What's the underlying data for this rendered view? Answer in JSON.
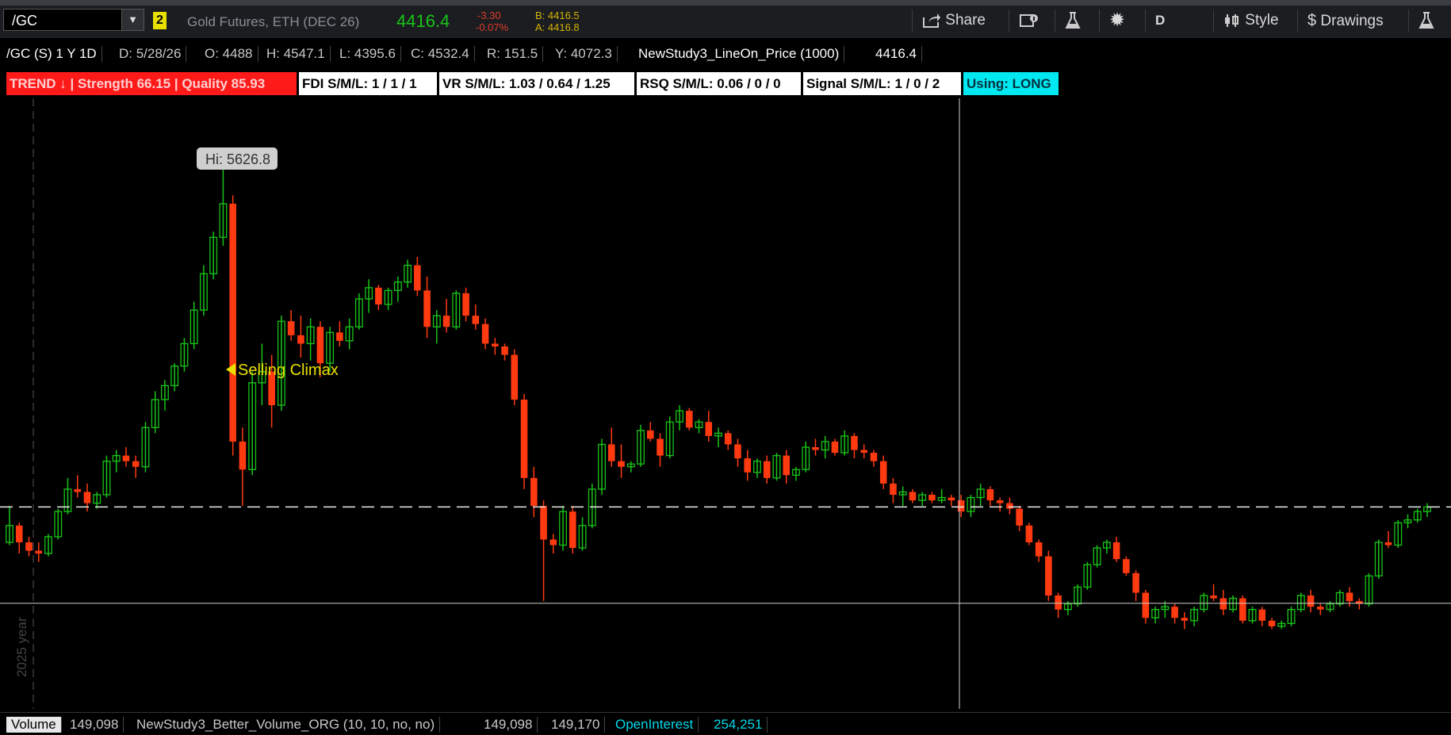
{
  "toolbar": {
    "symbol": "/GC",
    "link_badge": "2",
    "description": "Gold Futures, ETH (DEC 26)",
    "last": "4416.4",
    "change_abs": "-3.30",
    "change_pct": "-0.07%",
    "bid": "B: 4416.5",
    "ask": "A: 4416.8",
    "share_label": "Share",
    "aggregation_label": "D",
    "style_label": "Style",
    "drawings_label": "Drawings",
    "accent_color": "#18c418",
    "negative_color": "#e03a2a"
  },
  "info_row": {
    "chart_id": "/GC (S) 1 Y 1D",
    "date": "D: 5/28/26",
    "open": "O: 4488",
    "high": "H: 4547.1",
    "low": "L: 4395.6",
    "close": "C: 4532.4",
    "range": "R: 151.5",
    "y": "Y: 4072.3",
    "study": "NewStudy3_LineOn_Price (1000)",
    "study_value": "4416.4"
  },
  "labels": {
    "trend": "TREND ↓ | Strength 66.15 | Quality 85.93",
    "fdi": "FDI S/M/L: 1 / 1 / 1",
    "vr": "VR  S/M/L: 1.03 / 0.64 / 1.25",
    "rsq": "RSQ S/M/L: 0.06 / 0 / 0",
    "signal": "Signal S/M/L: 1 / 0 / 2",
    "using": "Using: LONG"
  },
  "chart_data": {
    "type": "candlestick",
    "hi_bubble": "Hi: 5626.8",
    "annotation": "Selling Climax",
    "year_label": "2025 year",
    "up_color": "#18c418",
    "down_color": "#ff3a10",
    "ohlc": [
      [
        4290,
        4420,
        4280,
        4350
      ],
      [
        4350,
        4360,
        4250,
        4290
      ],
      [
        4290,
        4310,
        4240,
        4260
      ],
      [
        4260,
        4290,
        4220,
        4250
      ],
      [
        4250,
        4320,
        4240,
        4310
      ],
      [
        4310,
        4410,
        4300,
        4400
      ],
      [
        4400,
        4520,
        4390,
        4480
      ],
      [
        4480,
        4530,
        4450,
        4470
      ],
      [
        4470,
        4500,
        4400,
        4430
      ],
      [
        4430,
        4470,
        4410,
        4460
      ],
      [
        4460,
        4600,
        4450,
        4580
      ],
      [
        4580,
        4620,
        4540,
        4600
      ],
      [
        4600,
        4630,
        4560,
        4580
      ],
      [
        4580,
        4600,
        4520,
        4560
      ],
      [
        4560,
        4720,
        4540,
        4700
      ],
      [
        4700,
        4830,
        4680,
        4800
      ],
      [
        4800,
        4870,
        4760,
        4850
      ],
      [
        4850,
        4930,
        4830,
        4920
      ],
      [
        4920,
        5020,
        4900,
        5000
      ],
      [
        5000,
        5150,
        4980,
        5120
      ],
      [
        5120,
        5280,
        5100,
        5250
      ],
      [
        5250,
        5400,
        5230,
        5380
      ],
      [
        5380,
        5627,
        5350,
        5500
      ],
      [
        5500,
        5530,
        4600,
        4650
      ],
      [
        4650,
        4700,
        4420,
        4550
      ],
      [
        4550,
        4900,
        4530,
        4860
      ],
      [
        4860,
        5000,
        4780,
        4900
      ],
      [
        4900,
        4960,
        4700,
        4780
      ],
      [
        4780,
        5100,
        4760,
        5080
      ],
      [
        5080,
        5120,
        5010,
        5030
      ],
      [
        5030,
        5100,
        4950,
        5000
      ],
      [
        5000,
        5090,
        4940,
        5060
      ],
      [
        5060,
        5080,
        4880,
        4930
      ],
      [
        4930,
        5060,
        4900,
        5040
      ],
      [
        5040,
        5080,
        4990,
        5010
      ],
      [
        5010,
        5090,
        4980,
        5060
      ],
      [
        5060,
        5180,
        5050,
        5160
      ],
      [
        5160,
        5230,
        5110,
        5200
      ],
      [
        5200,
        5210,
        5120,
        5140
      ],
      [
        5140,
        5200,
        5120,
        5190
      ],
      [
        5190,
        5240,
        5150,
        5220
      ],
      [
        5220,
        5300,
        5200,
        5280
      ],
      [
        5280,
        5310,
        5170,
        5190
      ],
      [
        5190,
        5240,
        5020,
        5060
      ],
      [
        5060,
        5120,
        5000,
        5100
      ],
      [
        5100,
        5160,
        5040,
        5060
      ],
      [
        5060,
        5190,
        5050,
        5180
      ],
      [
        5180,
        5200,
        5080,
        5100
      ],
      [
        5100,
        5140,
        5050,
        5070
      ],
      [
        5070,
        5090,
        4980,
        5000
      ],
      [
        5000,
        5020,
        4960,
        4990
      ],
      [
        4990,
        5000,
        4940,
        4960
      ],
      [
        4960,
        4980,
        4780,
        4800
      ],
      [
        4800,
        4820,
        4480,
        4520
      ],
      [
        4520,
        4560,
        4380,
        4420
      ],
      [
        4420,
        4440,
        4080,
        4300
      ],
      [
        4300,
        4320,
        4250,
        4280
      ],
      [
        4280,
        4420,
        4260,
        4400
      ],
      [
        4400,
        4420,
        4250,
        4270
      ],
      [
        4270,
        4380,
        4260,
        4350
      ],
      [
        4350,
        4500,
        4340,
        4480
      ],
      [
        4480,
        4660,
        4460,
        4640
      ],
      [
        4640,
        4700,
        4560,
        4580
      ],
      [
        4580,
        4640,
        4520,
        4560
      ],
      [
        4560,
        4580,
        4540,
        4570
      ],
      [
        4570,
        4710,
        4560,
        4690
      ],
      [
        4690,
        4720,
        4650,
        4660
      ],
      [
        4660,
        4680,
        4560,
        4600
      ],
      [
        4600,
        4740,
        4590,
        4720
      ],
      [
        4720,
        4780,
        4690,
        4760
      ],
      [
        4760,
        4770,
        4690,
        4700
      ],
      [
        4700,
        4730,
        4680,
        4720
      ],
      [
        4720,
        4760,
        4650,
        4670
      ],
      [
        4670,
        4700,
        4630,
        4680
      ],
      [
        4680,
        4690,
        4620,
        4640
      ],
      [
        4640,
        4660,
        4560,
        4590
      ],
      [
        4590,
        4620,
        4510,
        4540
      ],
      [
        4540,
        4590,
        4520,
        4580
      ],
      [
        4580,
        4600,
        4500,
        4520
      ],
      [
        4520,
        4610,
        4510,
        4600
      ],
      [
        4600,
        4620,
        4500,
        4530
      ],
      [
        4530,
        4560,
        4510,
        4550
      ],
      [
        4550,
        4650,
        4540,
        4630
      ],
      [
        4630,
        4660,
        4600,
        4620
      ],
      [
        4620,
        4670,
        4590,
        4650
      ],
      [
        4650,
        4660,
        4600,
        4610
      ],
      [
        4610,
        4690,
        4600,
        4670
      ],
      [
        4670,
        4680,
        4590,
        4620
      ],
      [
        4620,
        4640,
        4590,
        4610
      ],
      [
        4610,
        4620,
        4560,
        4580
      ],
      [
        4580,
        4600,
        4480,
        4500
      ],
      [
        4500,
        4520,
        4430,
        4460
      ],
      [
        4460,
        4490,
        4420,
        4470
      ],
      [
        4470,
        4480,
        4430,
        4440
      ],
      [
        4440,
        4470,
        4420,
        4460
      ],
      [
        4460,
        4470,
        4430,
        4440
      ],
      [
        4440,
        4480,
        4430,
        4450
      ],
      [
        4450,
        4460,
        4420,
        4440
      ],
      [
        4440,
        4460,
        4380,
        4400
      ],
      [
        4400,
        4460,
        4380,
        4450
      ],
      [
        4450,
        4500,
        4420,
        4480
      ],
      [
        4480,
        4490,
        4420,
        4440
      ],
      [
        4440,
        4450,
        4400,
        4430
      ],
      [
        4430,
        4450,
        4390,
        4410
      ],
      [
        4410,
        4420,
        4330,
        4350
      ],
      [
        4350,
        4360,
        4280,
        4290
      ],
      [
        4290,
        4300,
        4220,
        4240
      ],
      [
        4240,
        4260,
        4080,
        4100
      ],
      [
        4100,
        4110,
        4020,
        4050
      ],
      [
        4050,
        4080,
        4030,
        4070
      ],
      [
        4070,
        4140,
        4060,
        4130
      ],
      [
        4130,
        4220,
        4120,
        4210
      ],
      [
        4210,
        4280,
        4200,
        4270
      ],
      [
        4270,
        4300,
        4250,
        4290
      ],
      [
        4290,
        4310,
        4220,
        4230
      ],
      [
        4230,
        4240,
        4170,
        4180
      ],
      [
        4180,
        4190,
        4080,
        4110
      ],
      [
        4110,
        4120,
        4000,
        4020
      ],
      [
        4020,
        4060,
        4000,
        4050
      ],
      [
        4050,
        4080,
        4020,
        4060
      ],
      [
        4060,
        4070,
        4000,
        4020
      ],
      [
        4020,
        4040,
        3980,
        4010
      ],
      [
        4010,
        4060,
        3990,
        4050
      ],
      [
        4050,
        4110,
        4040,
        4100
      ],
      [
        4100,
        4140,
        4080,
        4090
      ],
      [
        4090,
        4120,
        4030,
        4050
      ],
      [
        4050,
        4100,
        4040,
        4090
      ],
      [
        4090,
        4100,
        4000,
        4010
      ],
      [
        4010,
        4060,
        4000,
        4050
      ],
      [
        4050,
        4060,
        3990,
        4010
      ],
      [
        4010,
        4020,
        3980,
        3990
      ],
      [
        3990,
        4010,
        3980,
        4000
      ],
      [
        4000,
        4060,
        3990,
        4050
      ],
      [
        4050,
        4110,
        4040,
        4100
      ],
      [
        4100,
        4120,
        4040,
        4060
      ],
      [
        4060,
        4070,
        4030,
        4050
      ],
      [
        4050,
        4080,
        4040,
        4070
      ],
      [
        4070,
        4120,
        4060,
        4110
      ],
      [
        4110,
        4130,
        4060,
        4080
      ],
      [
        4080,
        4090,
        4050,
        4070
      ],
      [
        4070,
        4180,
        4060,
        4170
      ],
      [
        4170,
        4300,
        4160,
        4290
      ],
      [
        4290,
        4330,
        4270,
        4280
      ],
      [
        4280,
        4370,
        4270,
        4360
      ],
      [
        4360,
        4390,
        4340,
        4370
      ],
      [
        4370,
        4410,
        4360,
        4400
      ],
      [
        4400,
        4430,
        4380,
        4416.4
      ]
    ],
    "price_line": 4416.4,
    "cursor_price": 4072.3
  },
  "volume_row": {
    "label": "Volume",
    "value": "149,098",
    "study": "NewStudy3_Better_Volume_ORG (10, 10, no, no)",
    "study_v1": "149,098",
    "study_v2": "149,170",
    "oi_label": "OpenInterest",
    "oi_value": "254,251",
    "oi_color": "#00d8e8"
  }
}
